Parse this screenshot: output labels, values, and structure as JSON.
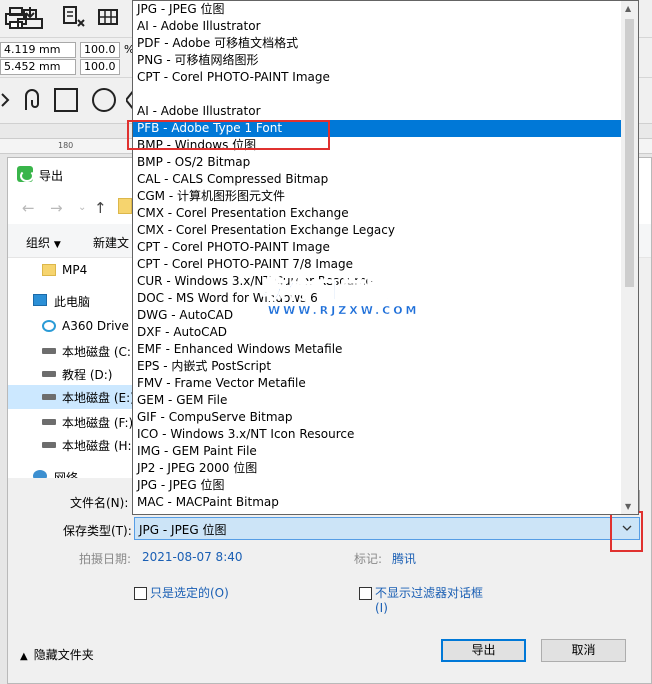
{
  "background": {
    "fields": {
      "width_mm": "4.119 mm",
      "height_mm": "5.452 mm",
      "scale_x": "100.0",
      "scale_y": "100.0",
      "percent": "%"
    },
    "ruler_tick": "180"
  },
  "dialog": {
    "title": "导出",
    "commands": {
      "organize": "组织",
      "new_folder": "新建文"
    },
    "nav_items": [
      {
        "label": "MP4",
        "icon": "folder-icon"
      },
      {
        "label": "此电脑",
        "icon": "pc-icon"
      },
      {
        "label": "A360 Drive",
        "icon": "cloud-icon"
      },
      {
        "label": "本地磁盘 (C:)",
        "icon": "drive-icon"
      },
      {
        "label": "教程 (D:)",
        "icon": "drive-icon"
      },
      {
        "label": "本地磁盘 (E:)",
        "icon": "drive-icon",
        "selected": true
      },
      {
        "label": "本地磁盘 (F:)",
        "icon": "drive-icon"
      },
      {
        "label": "本地磁盘 (H:)",
        "icon": "drive-icon"
      },
      {
        "label": "网络",
        "icon": "network-icon"
      }
    ],
    "filename_label": "文件名(N):",
    "filename_value": "",
    "type_label": "保存类型(T):",
    "type_value": "JPG - JPEG 位图",
    "date_label": "拍摄日期:",
    "date_value": "2021-08-07 8:40",
    "tag_label": "标记:",
    "tag_value": "腾讯",
    "only_selected": "只是选定的(O)",
    "no_filter_dialog_line1": "不显示过滤器对话框",
    "no_filter_dialog_line2": "(I)",
    "hide_folders": "隐藏文件夹",
    "export_button": "导出",
    "cancel_button": "取消"
  },
  "dropdown": {
    "items": [
      "JPG - JPEG 位图",
      "AI - Adobe Illustrator",
      "PDF - Adobe 可移植文档格式",
      "PNG - 可移植网络图形",
      "CPT - Corel PHOTO-PAINT Image",
      "",
      "AI - Adobe Illustrator",
      "PFB - Adobe Type 1 Font",
      "BMP - Windows 位图",
      "BMP - OS/2 Bitmap",
      "CAL - CALS Compressed Bitmap",
      "CGM - 计算机图形图元文件",
      "CMX - Corel Presentation Exchange",
      "CMX - Corel Presentation Exchange Legacy",
      "CPT - Corel PHOTO-PAINT Image",
      "CPT - Corel PHOTO-PAINT 7/8 Image",
      "CUR - Windows 3.x/NT Cursor Resource",
      "DOC - MS Word for Windows 6",
      "DWG - AutoCAD",
      "DXF - AutoCAD",
      "EMF - Enhanced Windows Metafile",
      "EPS - 内嵌式 PostScript",
      "FMV - Frame Vector Metafile",
      "GEM - GEM File",
      "GIF - CompuServe Bitmap",
      "ICO - Windows 3.x/NT Icon Resource",
      "IMG - GEM Paint File",
      "JP2 - JPEG 2000 位图",
      "JPG - JPEG 位图",
      "MAC - MACPaint Bitmap"
    ],
    "highlighted_index": 7
  },
  "watermark": {
    "title": "软件自学网",
    "url": "WWW.RJZXW.COM"
  },
  "colors": {
    "highlight": "#0078d7",
    "annotation": "#e0312f",
    "link": "#1a5fb4"
  }
}
